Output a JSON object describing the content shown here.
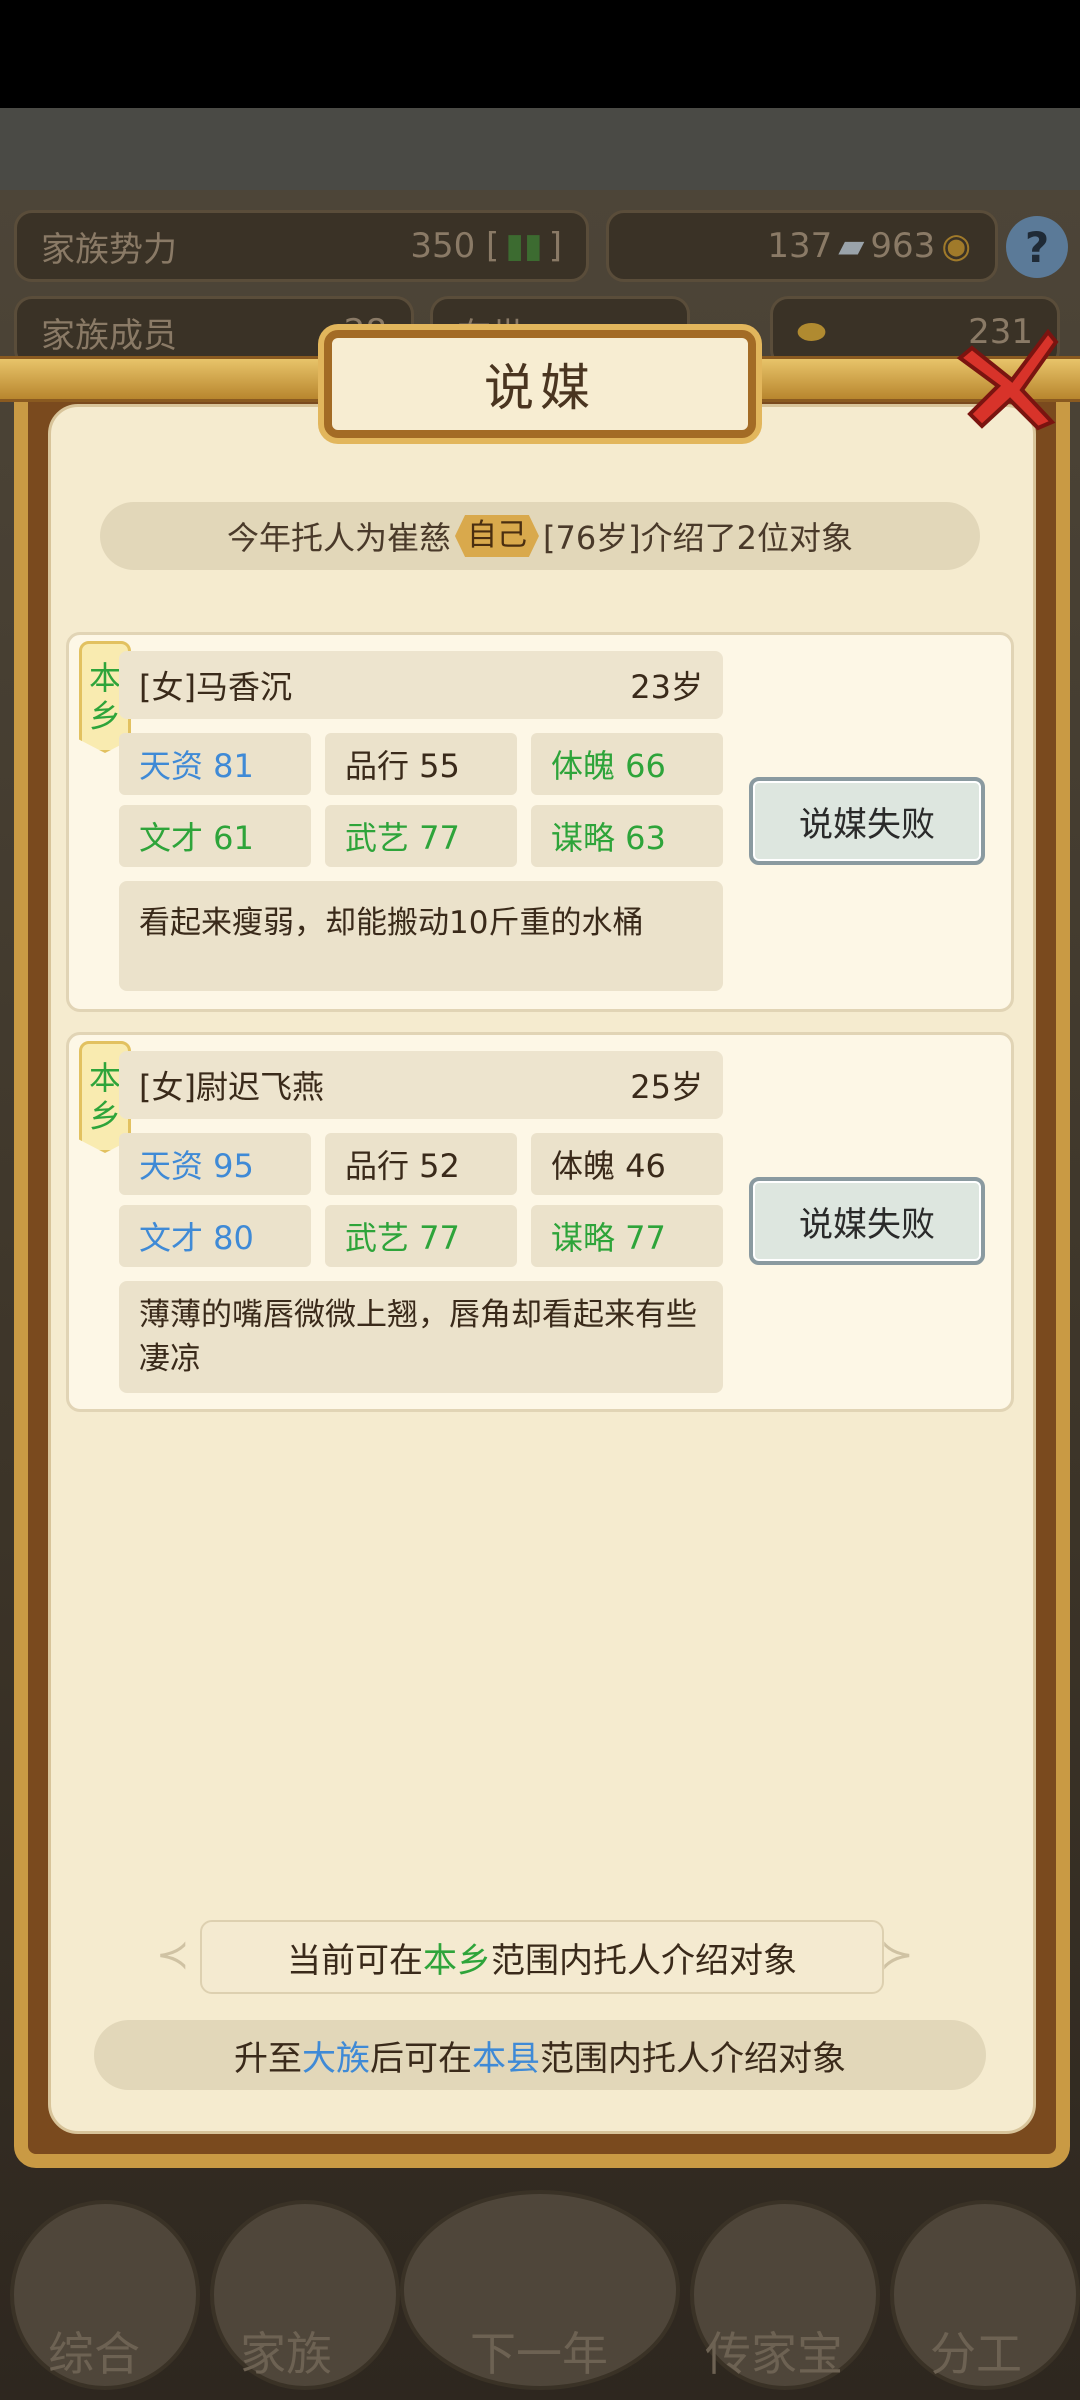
{
  "background": {
    "family_power_label": "家族势力",
    "family_power_value": "350 [",
    "family_power_end": "]",
    "resources": "137",
    "resources2": "963",
    "family_members_label": "家族成员",
    "family_members_value": "28",
    "second_stat": "在世",
    "gold_value": "231"
  },
  "dialog": {
    "title": "说媒",
    "info": {
      "prefix": "今年托人为崔慈",
      "self_tag": "自己",
      "suffix": "[76岁]介绍了2位对象"
    },
    "candidates": [
      {
        "origin_1": "本",
        "origin_2": "乡",
        "name": "[女]马香沉",
        "age": "23岁",
        "stats": [
          {
            "label": "天资 81",
            "color": "blue"
          },
          {
            "label": "品行 55",
            "color": "dark"
          },
          {
            "label": "体魄 66",
            "color": "green"
          },
          {
            "label": "文才 61",
            "color": "green"
          },
          {
            "label": "武艺 77",
            "color": "green"
          },
          {
            "label": "谋略 63",
            "color": "green"
          }
        ],
        "description": "看起来瘦弱，却能搬动10斤重的水桶",
        "button": "说媒失败"
      },
      {
        "origin_1": "本",
        "origin_2": "乡",
        "name": "[女]尉迟飞燕",
        "age": "25岁",
        "stats": [
          {
            "label": "天资 95",
            "color": "blue"
          },
          {
            "label": "品行 52",
            "color": "dark"
          },
          {
            "label": "体魄 46",
            "color": "dark"
          },
          {
            "label": "文才 80",
            "color": "blue"
          },
          {
            "label": "武艺 77",
            "color": "green"
          },
          {
            "label": "谋略 77",
            "color": "green"
          }
        ],
        "description": "薄薄的嘴唇微微上翘，唇角却看起来有些凄凉",
        "button": "说媒失败"
      }
    ],
    "notice1": {
      "a": "当前可在",
      "b": "本乡",
      "c": "范围内托人介绍对象"
    },
    "notice2": {
      "a": "升至",
      "b": "大族",
      "c": "后可在",
      "d": "本县",
      "e": "范围内托人介绍对象"
    }
  },
  "nav": [
    "综合",
    "家族",
    "下一年",
    "传家宝",
    "分工"
  ],
  "colors": {
    "accent_gold": "#c99a44",
    "green": "#2ea43a",
    "blue": "#3f8ad6"
  }
}
